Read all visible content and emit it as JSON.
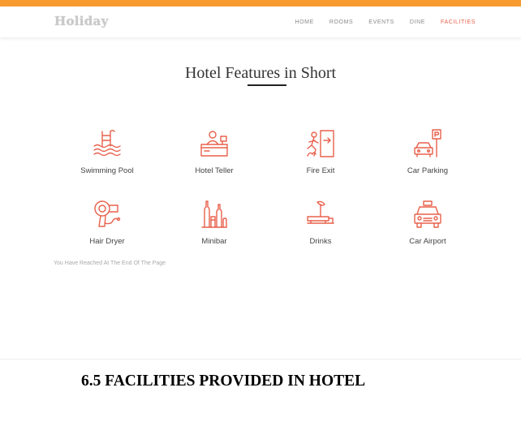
{
  "header": {
    "logo": "Holiday",
    "nav": [
      "HOME",
      "ROOMS",
      "EVENTS",
      "DINE",
      "FACILITIES"
    ],
    "active_nav": "FACILITIES",
    "accent_color": "#f79b2e"
  },
  "main": {
    "title": "Hotel Features in Short",
    "features": [
      {
        "label": "Swimming Pool",
        "icon": "swimming-pool-icon"
      },
      {
        "label": "Hotel Teller",
        "icon": "hotel-teller-icon"
      },
      {
        "label": "Fire Exit",
        "icon": "fire-exit-icon"
      },
      {
        "label": "Car Parking",
        "icon": "car-parking-icon"
      },
      {
        "label": "Hair Dryer",
        "icon": "hair-dryer-icon"
      },
      {
        "label": "Minibar",
        "icon": "minibar-icon"
      },
      {
        "label": "Drinks",
        "icon": "drinks-icon"
      },
      {
        "label": "Car Airport",
        "icon": "car-airport-icon"
      }
    ],
    "end_note": "You Have Reached At The End Of The Page",
    "icon_color": "#e8604c"
  },
  "document": {
    "caption": "6.5 FACILITIES PROVIDED IN HOTEL"
  }
}
